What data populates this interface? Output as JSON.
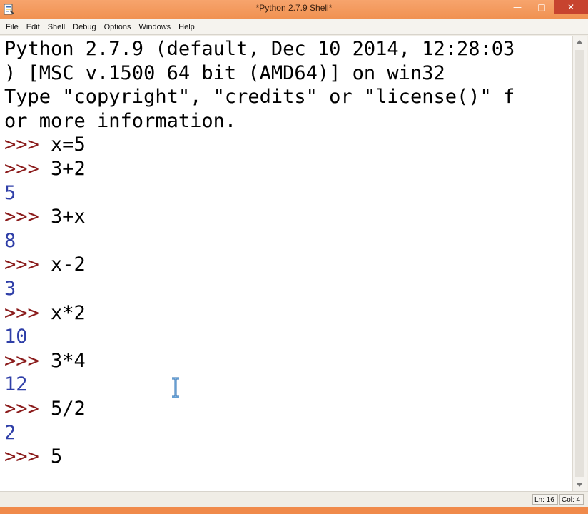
{
  "window": {
    "title": "*Python 2.7.9 Shell*"
  },
  "menu": {
    "items": [
      "File",
      "Edit",
      "Shell",
      "Debug",
      "Options",
      "Windows",
      "Help"
    ]
  },
  "shell": {
    "lines": [
      {
        "kind": "banner",
        "text": "Python 2.7.9 (default, Dec 10 2014, 12:28:03"
      },
      {
        "kind": "banner",
        "text": ") [MSC v.1500 64 bit (AMD64)] on win32"
      },
      {
        "kind": "banner",
        "text": "Type \"copyright\", \"credits\" or \"license()\" f"
      },
      {
        "kind": "banner",
        "text": "or more information."
      },
      {
        "kind": "input",
        "prompt": ">>> ",
        "text": "x=5"
      },
      {
        "kind": "input",
        "prompt": ">>> ",
        "text": "3+2"
      },
      {
        "kind": "output",
        "text": "5"
      },
      {
        "kind": "input",
        "prompt": ">>> ",
        "text": "3+x"
      },
      {
        "kind": "output",
        "text": "8"
      },
      {
        "kind": "input",
        "prompt": ">>> ",
        "text": "x-2"
      },
      {
        "kind": "output",
        "text": "3"
      },
      {
        "kind": "input",
        "prompt": ">>> ",
        "text": "x*2"
      },
      {
        "kind": "output",
        "text": "10"
      },
      {
        "kind": "input",
        "prompt": ">>> ",
        "text": "3*4"
      },
      {
        "kind": "output",
        "text": "12"
      },
      {
        "kind": "input",
        "prompt": ">>> ",
        "text": "5/2"
      },
      {
        "kind": "output",
        "text": "2"
      },
      {
        "kind": "input",
        "prompt": ">>> ",
        "text": "5"
      }
    ]
  },
  "status": {
    "line": "Ln: 16",
    "col": "Col: 4"
  },
  "colors": {
    "prompt": "#8b1c1c",
    "output": "#2f3fa8",
    "titlebar": "#f09150"
  },
  "icons": {
    "app": "idle-shell-icon",
    "minimize": "minimize-icon",
    "maximize": "maximize-icon",
    "close": "close-icon",
    "cursor": "text-cursor-icon"
  }
}
